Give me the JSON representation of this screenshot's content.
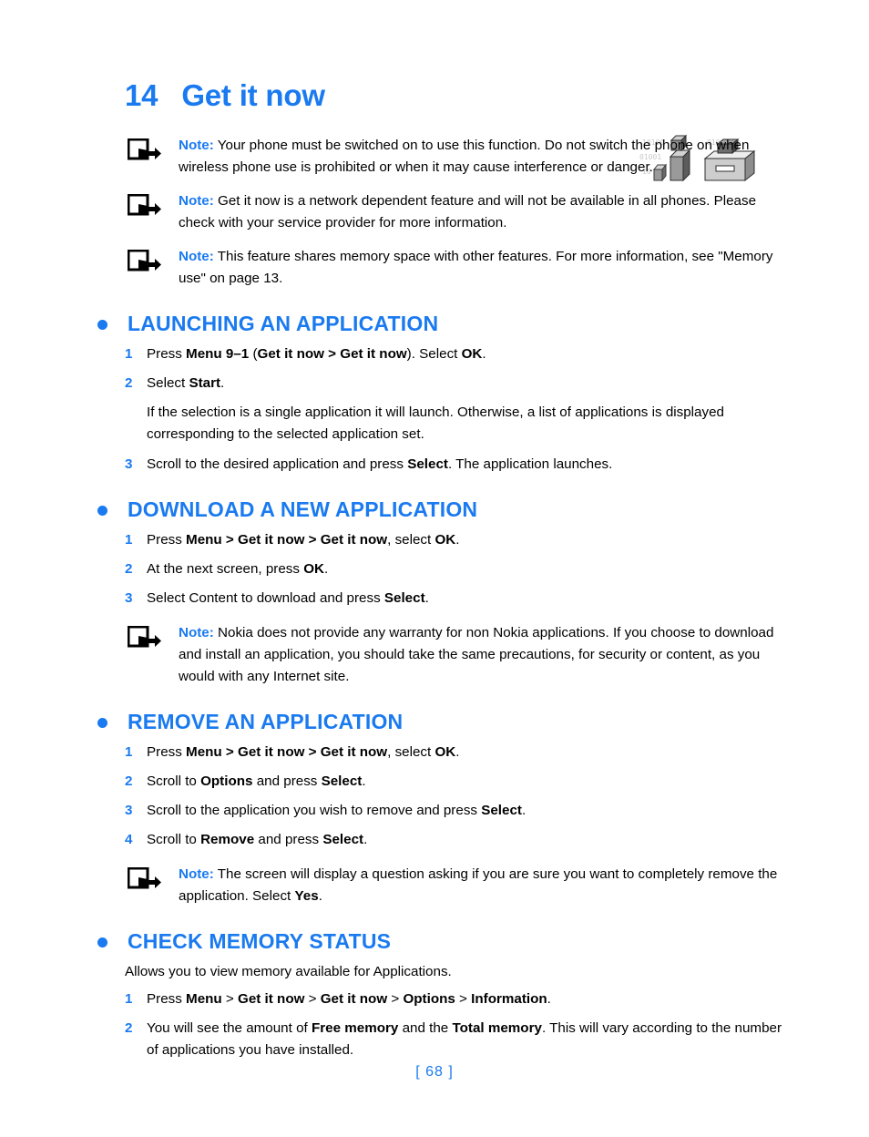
{
  "colors": {
    "accent": "#1a7af0",
    "text": "#000000",
    "background": "#ffffff"
  },
  "chapter": {
    "number": "14",
    "title": "Get it now"
  },
  "notes_top": [
    {
      "label": "Note:",
      "text": " Your phone must be switched on to use this function. Do not switch the phone on when wireless phone use is prohibited or when it may cause interference or danger.",
      "icon": "note-arrow-icon"
    },
    {
      "label": "Note:",
      "text": " Get it now is a network dependent feature and will not be available in all phones. Please check with your service provider for more information.",
      "icon": "note-arrow-icon"
    },
    {
      "label": "Note:",
      "text": " This feature shares memory space with other features. For more information, see \"Memory use\" on page 13.",
      "icon": "note-arrow-icon"
    }
  ],
  "illustration": {
    "name": "boxes-and-drawer-illustration",
    "binary_background": [
      "10100",
      "01001",
      "10",
      "010010",
      "10",
      "01"
    ]
  },
  "sections": [
    {
      "heading": "LAUNCHING AN APPLICATION",
      "bullet": "section-bullet",
      "steps": [
        {
          "num": "1",
          "html": "Press <b>Menu 9&#8211;1</b> (<b>Get it now &gt; Get it now</b>). Select <b>OK</b>."
        },
        {
          "num": "2",
          "html": "Select <b>Start</b>."
        }
      ],
      "paragraph": "If the selection is a single application it will launch. Otherwise, a list of applications is displayed corresponding to the selected application set.",
      "steps_after": [
        {
          "num": "3",
          "html": "Scroll to the desired application and press <b>Select</b>. The application launches."
        }
      ]
    },
    {
      "heading": "DOWNLOAD A NEW APPLICATION",
      "bullet": "section-bullet",
      "steps": [
        {
          "num": "1",
          "html": "Press <b>Menu &gt; Get it now &gt; Get it now</b>, select <b>OK</b>."
        },
        {
          "num": "2",
          "html": "At the next screen, press <b>OK</b>."
        },
        {
          "num": "3",
          "html": "Select Content to download and press <b>Select</b>."
        }
      ],
      "note": {
        "label": "Note:",
        "text": " Nokia does not provide any warranty for non Nokia applications. If you choose to download and install an application, you should take the same precautions, for security or content, as you would with any Internet site.",
        "icon": "note-arrow-icon"
      }
    },
    {
      "heading": "REMOVE AN APPLICATION",
      "bullet": "section-bullet",
      "steps": [
        {
          "num": "1",
          "html": "Press <b>Menu &gt; Get it now &gt; Get it now</b>, select <b>OK</b>."
        },
        {
          "num": "2",
          "html": "Scroll to <b>Options</b> and press <b>Select</b>."
        },
        {
          "num": "3",
          "html": "Scroll to the application you wish to remove and press <b>Select</b>."
        },
        {
          "num": "4",
          "html": "Scroll to <b>Remove</b> and press <b>Select</b>."
        }
      ],
      "note": {
        "label": "Note:",
        "text": " The screen will display a question asking if you are sure you want to completely remove the application. Select ",
        "text_bold_tail": "Yes",
        "text_tail": ".",
        "icon": "note-arrow-icon"
      }
    },
    {
      "heading": "CHECK MEMORY STATUS",
      "bullet": "section-bullet",
      "intro": "Allows you to view memory available for Applications.",
      "steps": [
        {
          "num": "1",
          "html": "Press <b>Menu</b> &gt; <b>Get it now</b> &gt; <b>Get it now</b> &gt; <b>Options</b> &gt; <b>Information</b>."
        },
        {
          "num": "2",
          "html": "You will see the amount of <b>Free memory</b> and the <b>Total memory</b>. This will vary according to the number of applications you have installed."
        }
      ]
    }
  ],
  "footer": {
    "page_number": "[ 68 ]"
  }
}
